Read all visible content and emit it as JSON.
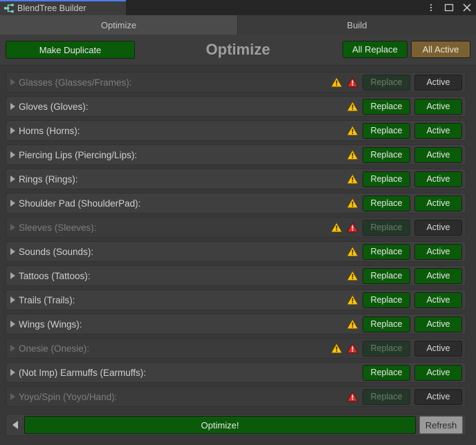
{
  "window": {
    "tab_title": "BlendTree Builder",
    "tab_icon": "blendtree-icon",
    "controls": [
      {
        "name": "kebab-menu-button",
        "icon": "kebab-menu-icon"
      },
      {
        "name": "maximize-button",
        "icon": "maximize-icon"
      },
      {
        "name": "close-button",
        "icon": "close-icon"
      }
    ]
  },
  "mode_tabs": [
    {
      "label": "Optimize",
      "selected": true
    },
    {
      "label": "Build",
      "selected": false
    }
  ],
  "header": {
    "make_duplicate_label": "Make Duplicate",
    "title": "Optimize",
    "all_replace_label": "All Replace",
    "all_active_label": "All Active"
  },
  "column_labels": {
    "replace": "Replace",
    "active": "Active"
  },
  "rows": [
    {
      "label": "Glasses (Glasses/Frames):",
      "dim": true,
      "warning": true,
      "error": true,
      "replace_enabled": false,
      "active_enabled": false
    },
    {
      "label": "Gloves (Gloves):",
      "dim": false,
      "warning": true,
      "error": false,
      "replace_enabled": true,
      "active_enabled": true
    },
    {
      "label": "Horns (Horns):",
      "dim": false,
      "warning": true,
      "error": false,
      "replace_enabled": true,
      "active_enabled": true
    },
    {
      "label": "Piercing Lips (Piercing/Lips):",
      "dim": false,
      "warning": true,
      "error": false,
      "replace_enabled": true,
      "active_enabled": true
    },
    {
      "label": "Rings (Rings):",
      "dim": false,
      "warning": true,
      "error": false,
      "replace_enabled": true,
      "active_enabled": true
    },
    {
      "label": "Shoulder Pad (ShoulderPad):",
      "dim": false,
      "warning": true,
      "error": false,
      "replace_enabled": true,
      "active_enabled": true
    },
    {
      "label": "Sleeves (Sleeves):",
      "dim": true,
      "warning": true,
      "error": true,
      "replace_enabled": false,
      "active_enabled": false
    },
    {
      "label": "Sounds (Sounds):",
      "dim": false,
      "warning": true,
      "error": false,
      "replace_enabled": true,
      "active_enabled": true
    },
    {
      "label": "Tattoos (Tattoos):",
      "dim": false,
      "warning": true,
      "error": false,
      "replace_enabled": true,
      "active_enabled": true
    },
    {
      "label": "Trails (Trails):",
      "dim": false,
      "warning": true,
      "error": false,
      "replace_enabled": true,
      "active_enabled": true
    },
    {
      "label": "Wings (Wings):",
      "dim": false,
      "warning": true,
      "error": false,
      "replace_enabled": true,
      "active_enabled": true
    },
    {
      "label": "Onesie (Onesie):",
      "dim": true,
      "warning": true,
      "error": true,
      "replace_enabled": false,
      "active_enabled": false
    },
    {
      "label": "(Not Imp) Earmuffs (Earmuffs):",
      "dim": false,
      "warning": false,
      "error": false,
      "replace_enabled": true,
      "active_enabled": true
    },
    {
      "label": "Yoyo/Spin (Yoyo/Hand):",
      "dim": true,
      "warning": false,
      "error": true,
      "replace_enabled": false,
      "active_enabled": false
    }
  ],
  "footer": {
    "back_icon": "triangle-left-icon",
    "optimize_label": "Optimize!",
    "refresh_label": "Refresh"
  },
  "colors": {
    "green": "#0a5a0a",
    "gold": "#7a6134",
    "warning": "#ffc107",
    "error": "#d62c2c",
    "accent_tab": "#4c7eff",
    "panel": "#383838",
    "row": "#3f3f3f"
  }
}
